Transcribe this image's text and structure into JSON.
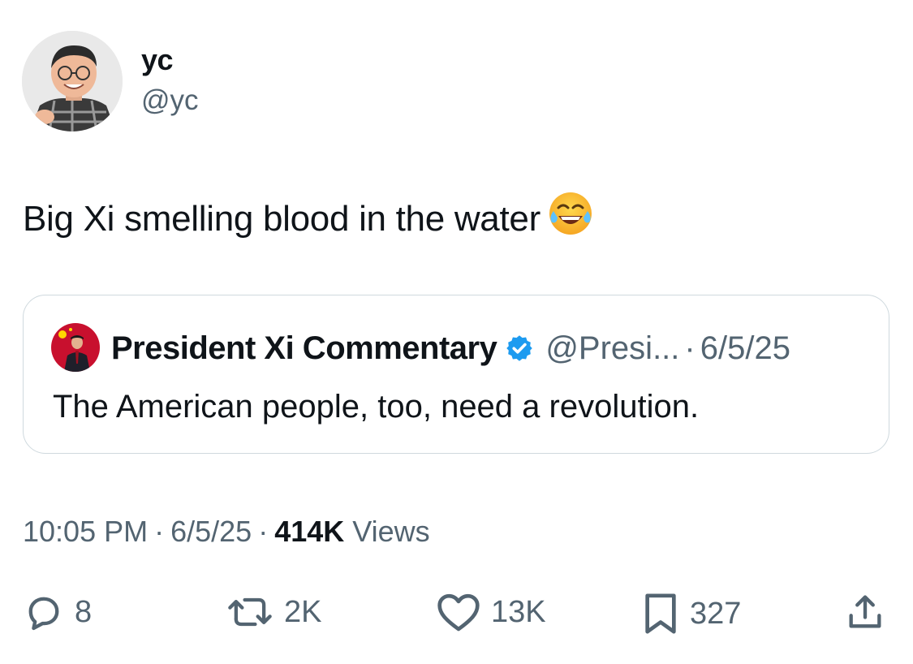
{
  "author": {
    "display_name": "yc",
    "handle": "@yc"
  },
  "tweet": {
    "text": "Big Xi smelling blood in the water",
    "emoji": "face-with-tears-of-joy"
  },
  "quoted_tweet": {
    "display_name": "President Xi Commentary",
    "verified": true,
    "handle": "@Presi...",
    "separator": "·",
    "date": "6/5/25",
    "text": "The American people, too, need a revolution."
  },
  "meta": {
    "time": "10:05 PM",
    "date": "6/5/25",
    "separator": "·",
    "views_count": "414K",
    "views_label": "Views"
  },
  "actions": {
    "replies": "8",
    "reposts": "2K",
    "likes": "13K",
    "bookmarks": "327"
  },
  "colors": {
    "text_primary": "#0f1419",
    "text_secondary": "#536471",
    "border": "#cfd9de",
    "verified_blue": "#1d9bf0"
  }
}
